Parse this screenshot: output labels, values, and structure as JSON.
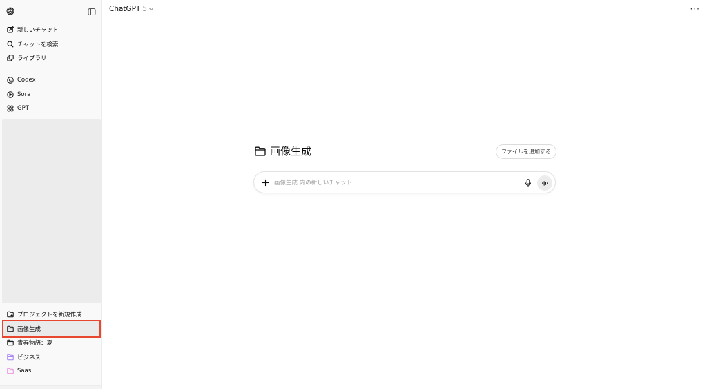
{
  "sidebar": {
    "nav": [
      {
        "label": "新しいチャット",
        "icon": "edit-icon"
      },
      {
        "label": "チャットを検索",
        "icon": "search-icon"
      },
      {
        "label": "ライブラリ",
        "icon": "library-icon"
      }
    ],
    "apps": [
      {
        "label": "Codex",
        "icon": "codex-icon"
      },
      {
        "label": "Sora",
        "icon": "play-circle-icon"
      },
      {
        "label": "GPT",
        "icon": "grid-icon"
      }
    ],
    "projects": [
      {
        "label": "プロジェクトを新規作成",
        "icon": "new-folder-icon",
        "color": "#0d0d0d"
      },
      {
        "label": "画像生成",
        "icon": "folder-icon",
        "color": "#0d0d0d"
      },
      {
        "label": "青春物語：夏",
        "icon": "folder-icon",
        "color": "#0d0d0d"
      },
      {
        "label": "ビジネス",
        "icon": "folder-icon",
        "color": "#a37cf0"
      },
      {
        "label": "Saas",
        "icon": "folder-icon",
        "color": "#e58adf"
      }
    ]
  },
  "header": {
    "model_name": "ChatGPT",
    "model_version": "5",
    "more_label": "···"
  },
  "main": {
    "project_title": "画像生成",
    "add_file_label": "ファイルを追加する",
    "composer_placeholder": "画像生成 内の新しいチャット",
    "plus_label": "+"
  },
  "colors": {
    "highlight": "#e8462f",
    "sidebar_bg": "#f9f9f9"
  }
}
